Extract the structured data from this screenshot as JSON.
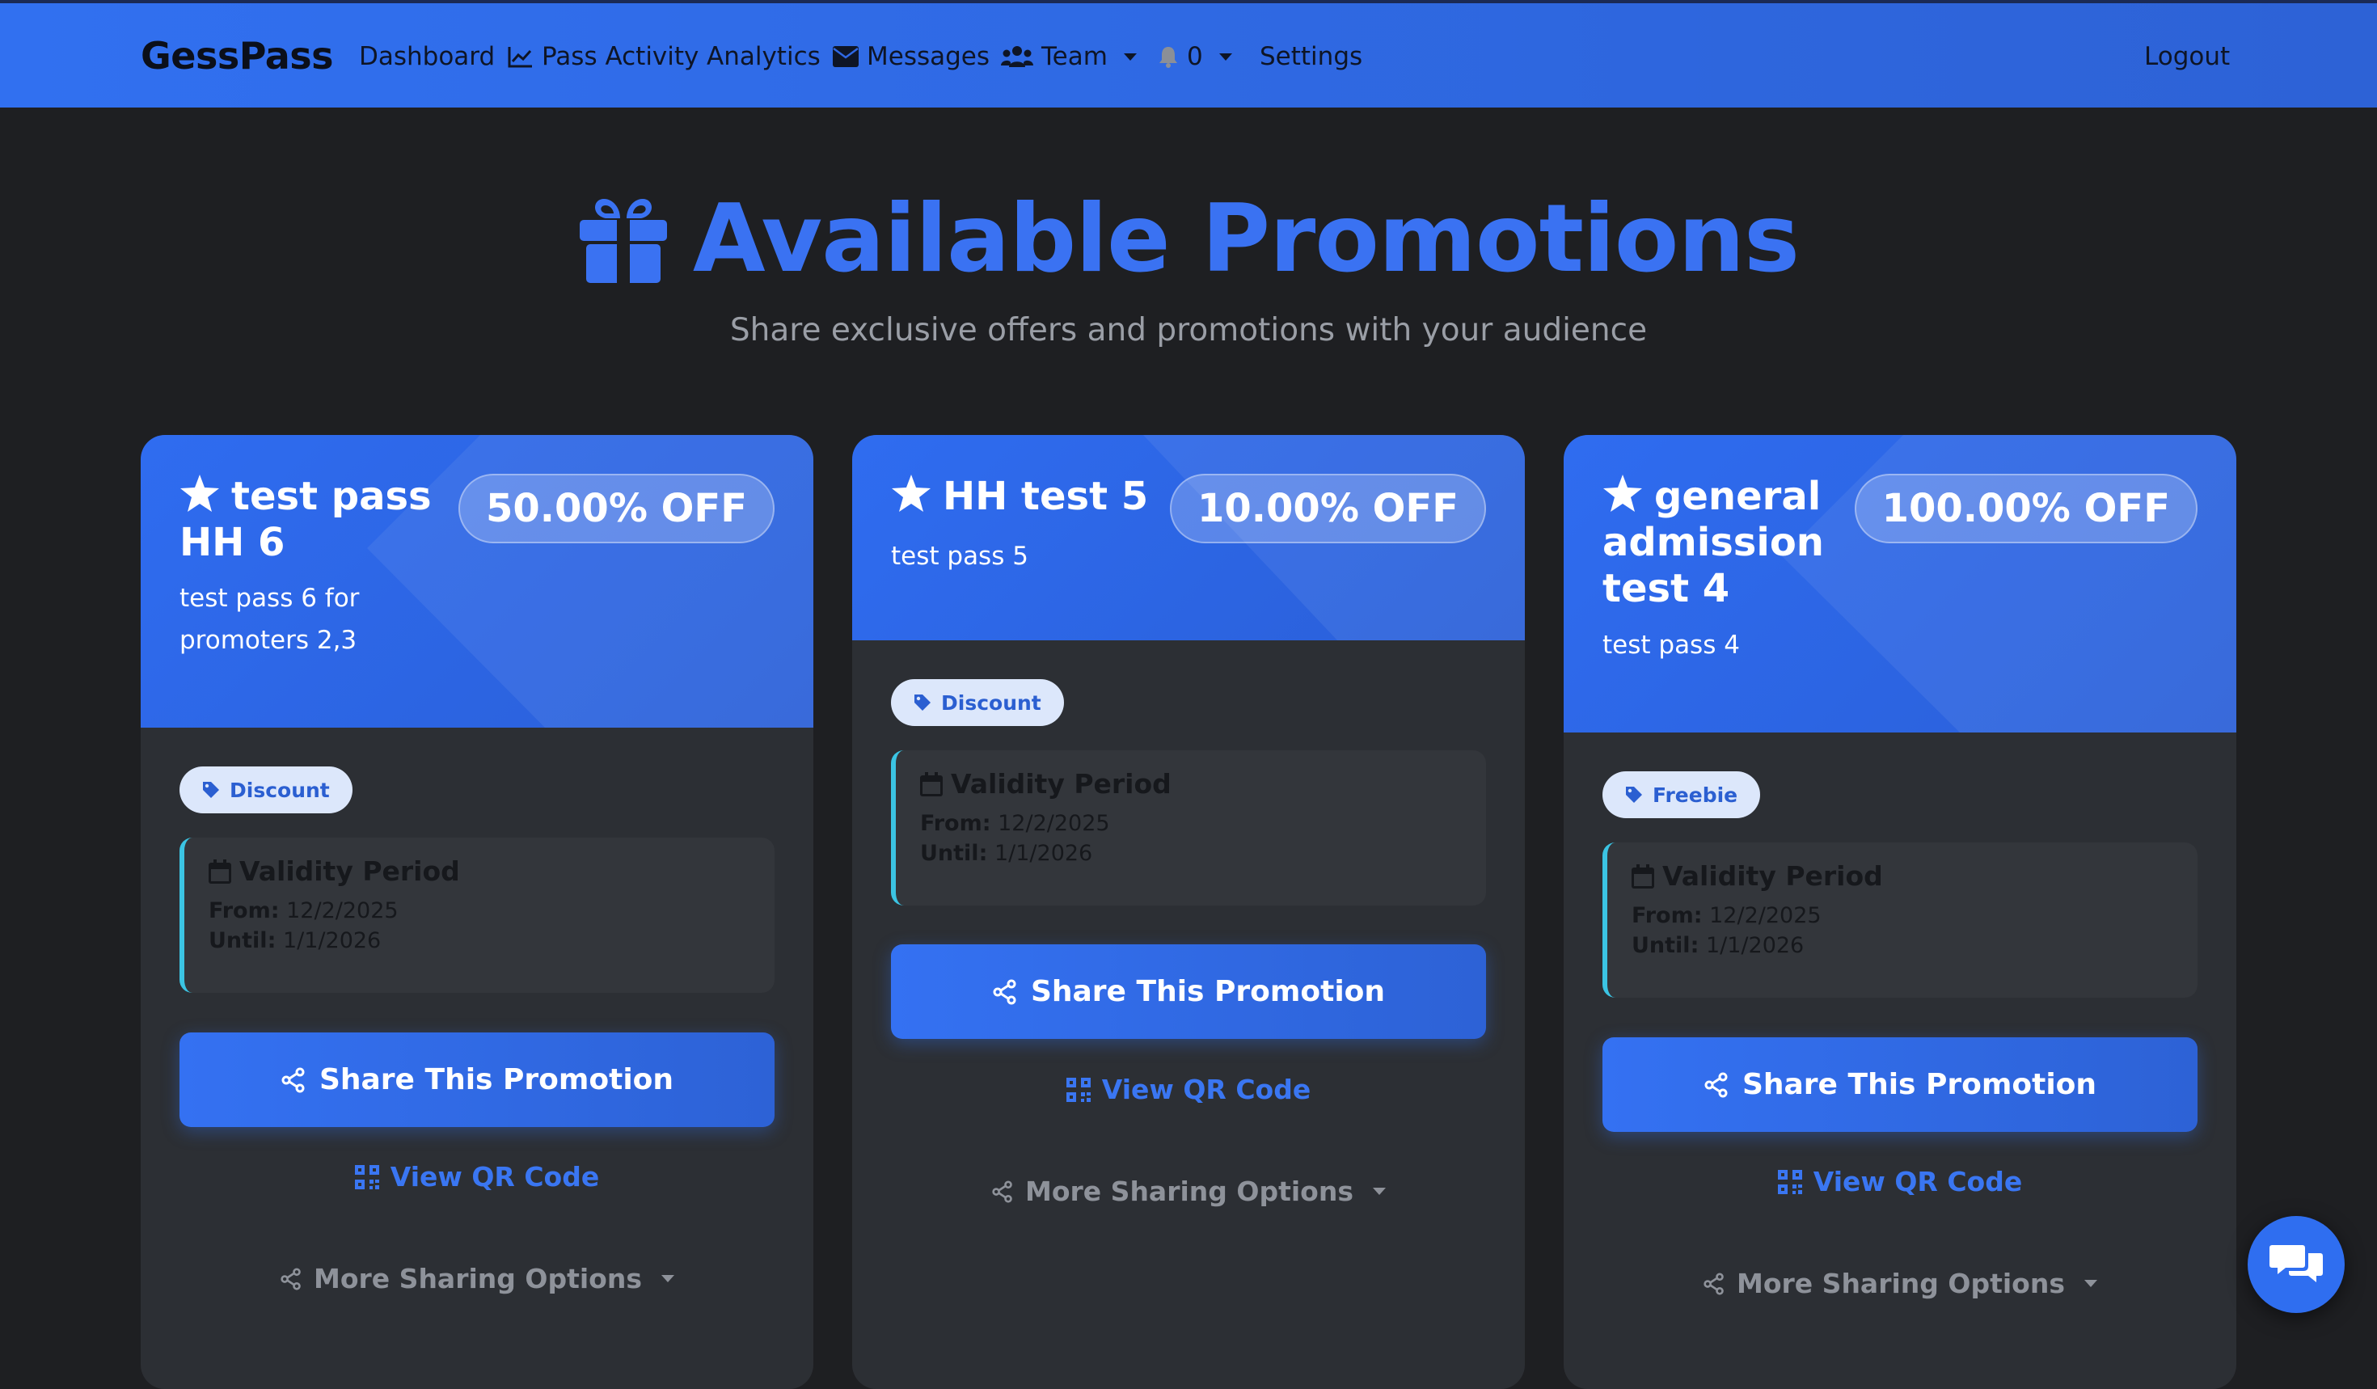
{
  "nav": {
    "brand": "GessPass",
    "dashboard": "Dashboard",
    "pass_activity": "Pass Activity",
    "analytics": "Analytics",
    "messages": "Messages",
    "team": "Team",
    "notifications_count": "0",
    "settings": "Settings",
    "logout": "Logout"
  },
  "hero": {
    "title": "Available Promotions",
    "subtitle": "Share exclusive offers and promotions with your audience"
  },
  "labels": {
    "validity_title": "Validity Period",
    "from": "From:",
    "until": "Until:",
    "share": "Share This Promotion",
    "qr": "View QR Code",
    "more": "More Sharing Options"
  },
  "promotions": [
    {
      "title": "test pass HH 6",
      "description": "test pass 6 for promoters 2,3",
      "discount": "50.00% OFF",
      "type": "Discount",
      "from": "12/2/2025",
      "until": "1/1/2026"
    },
    {
      "title": "HH test 5",
      "description": "test pass 5",
      "discount": "10.00% OFF",
      "type": "Discount",
      "from": "12/2/2025",
      "until": "1/1/2026"
    },
    {
      "title": "general admission test 4",
      "description": "test pass 4",
      "discount": "100.00% OFF",
      "type": "Freebie",
      "from": "12/2/2025",
      "until": "1/1/2026"
    }
  ],
  "colors": {
    "accent": "#3a72f2",
    "page_bg": "#1e1f22",
    "card_bg": "#2c2f34",
    "validity_border": "#3bc4e3"
  },
  "icons": {
    "hero": "gift-icon",
    "card_title": "star-icon",
    "badge": "tag-icon",
    "validity": "calendar-icon",
    "share": "share-icon",
    "qr": "qrcode-icon",
    "chat": "comments-icon"
  }
}
